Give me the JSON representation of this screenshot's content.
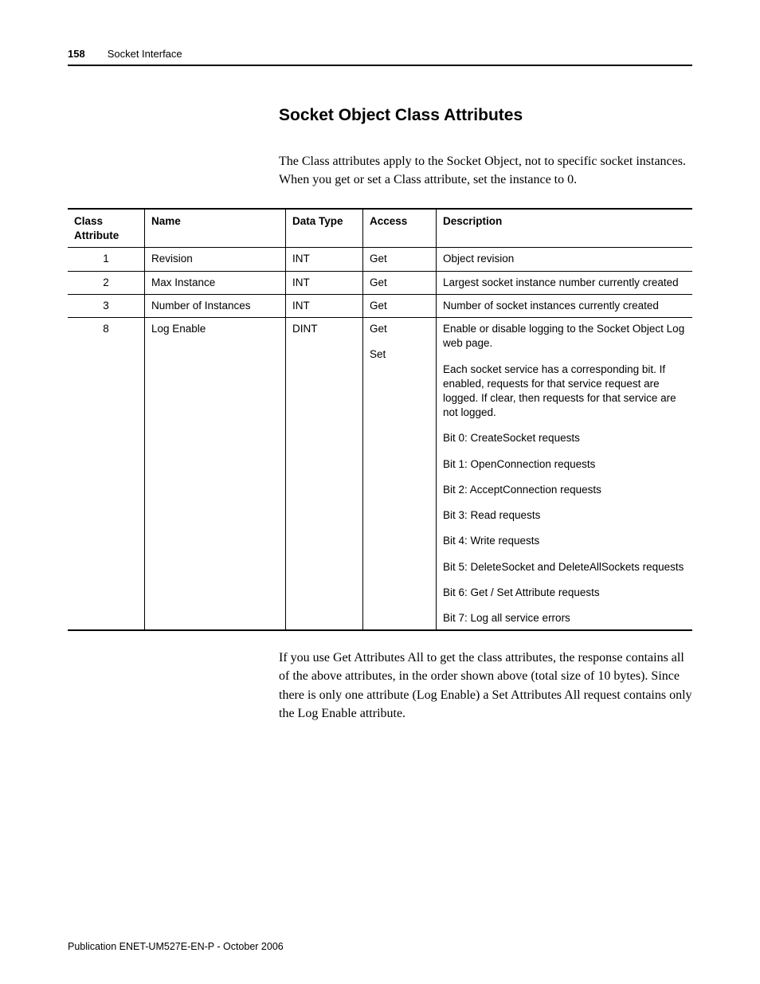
{
  "header": {
    "page_number": "158",
    "section": "Socket Interface"
  },
  "title": "Socket Object Class Attributes",
  "intro": "The Class attributes apply to the Socket Object, not to specific socket instances. When you get or set a Class attribute, set the instance to 0.",
  "table": {
    "columns": {
      "attr": "Class Attribute",
      "name": "Name",
      "type": "Data Type",
      "access": "Access",
      "desc": "Description"
    },
    "rows": [
      {
        "attr": "1",
        "name": "Revision",
        "type": "INT",
        "access": "Get",
        "desc": [
          "Object revision"
        ]
      },
      {
        "attr": "2",
        "name": "Max Instance",
        "type": "INT",
        "access": "Get",
        "desc": [
          "Largest socket instance number currently created"
        ]
      },
      {
        "attr": "3",
        "name": "Number of Instances",
        "type": "INT",
        "access": "Get",
        "desc": [
          "Number of socket instances currently created"
        ]
      },
      {
        "attr": "8",
        "name": "Log Enable",
        "type": "DINT",
        "access_lines": [
          "Get",
          "Set"
        ],
        "desc": [
          "Enable or disable logging to the Socket Object Log web page.",
          "Each socket service has a corresponding bit. If enabled, requests for that service request are logged. If clear, then requests for that service are not logged.",
          "Bit 0: CreateSocket requests",
          "Bit 1: OpenConnection requests",
          "Bit 2: AcceptConnection requests",
          "Bit 3: Read requests",
          "Bit 4: Write requests",
          "Bit 5: DeleteSocket and DeleteAllSockets requests",
          "Bit 6: Get / Set Attribute requests",
          "Bit 7: Log all service errors"
        ]
      }
    ]
  },
  "after_table": "If you use Get Attributes All to get the class attributes, the response contains all of the above attributes, in the order shown above (total size of 10 bytes). Since there is only one attribute (Log Enable) a Set Attributes All request contains only the Log Enable attribute.",
  "footer": "Publication ENET-UM527E-EN-P - October 2006"
}
